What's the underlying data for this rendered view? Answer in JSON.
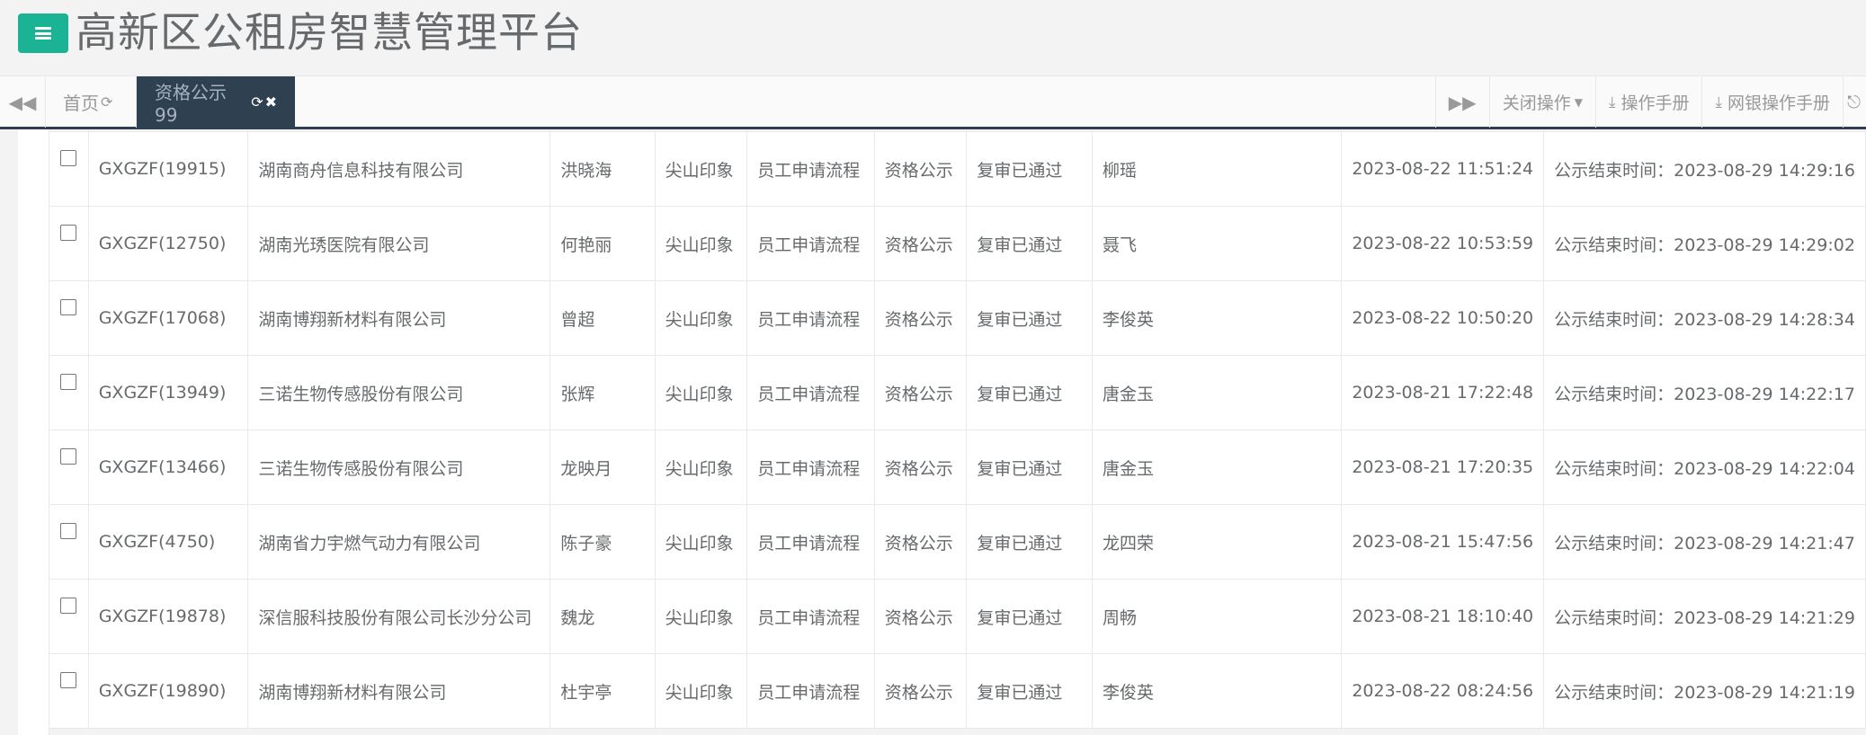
{
  "header": {
    "menu_icon": "hamburger-icon",
    "title": "高新区公租房智慧管理平台"
  },
  "tabbar": {
    "nav_left_icon": "double-chevron-left-icon",
    "tabs": [
      {
        "label": "首页",
        "icon": "refresh-icon"
      },
      {
        "label": "资格公示99",
        "icons": [
          "refresh-icon",
          "close-icon"
        ]
      }
    ],
    "nav_right_icon": "double-chevron-right-icon",
    "close_ops_label": "关闭操作",
    "manual_label": "操作手册",
    "bank_manual_label": "网银操作手册",
    "exit_icon": "exit-icon"
  },
  "table": {
    "rows": [
      {
        "code": "GXGZF(19915)",
        "company": "湖南商舟信息科技有限公司",
        "applicant": "洪晓海",
        "project": "尖山印象",
        "flow": "员工申请流程",
        "stage": "资格公示",
        "status": "复审已通过",
        "reviewer": "柳瑶",
        "time": "2023-08-22 11:51:24",
        "end_time": "公示结束时间：2023-08-29 14:29:16"
      },
      {
        "code": "GXGZF(12750)",
        "company": "湖南光琇医院有限公司",
        "applicant": "何艳丽",
        "project": "尖山印象",
        "flow": "员工申请流程",
        "stage": "资格公示",
        "status": "复审已通过",
        "reviewer": "聂飞",
        "time": "2023-08-22 10:53:59",
        "end_time": "公示结束时间：2023-08-29 14:29:02"
      },
      {
        "code": "GXGZF(17068)",
        "company": "湖南博翔新材料有限公司",
        "applicant": "曾超",
        "project": "尖山印象",
        "flow": "员工申请流程",
        "stage": "资格公示",
        "status": "复审已通过",
        "reviewer": "李俊英",
        "time": "2023-08-22 10:50:20",
        "end_time": "公示结束时间：2023-08-29 14:28:34"
      },
      {
        "code": "GXGZF(13949)",
        "company": "三诺生物传感股份有限公司",
        "applicant": "张辉",
        "project": "尖山印象",
        "flow": "员工申请流程",
        "stage": "资格公示",
        "status": "复审已通过",
        "reviewer": "唐金玉",
        "time": "2023-08-21 17:22:48",
        "end_time": "公示结束时间：2023-08-29 14:22:17"
      },
      {
        "code": "GXGZF(13466)",
        "company": "三诺生物传感股份有限公司",
        "applicant": "龙映月",
        "project": "尖山印象",
        "flow": "员工申请流程",
        "stage": "资格公示",
        "status": "复审已通过",
        "reviewer": "唐金玉",
        "time": "2023-08-21 17:20:35",
        "end_time": "公示结束时间：2023-08-29 14:22:04"
      },
      {
        "code": "GXGZF(4750)",
        "company": "湖南省力宇燃气动力有限公司",
        "applicant": "陈子豪",
        "project": "尖山印象",
        "flow": "员工申请流程",
        "stage": "资格公示",
        "status": "复审已通过",
        "reviewer": "龙四荣",
        "time": "2023-08-21 15:47:56",
        "end_time": "公示结束时间：2023-08-29 14:21:47"
      },
      {
        "code": "GXGZF(19878)",
        "company": "深信服科技股份有限公司长沙分公司",
        "applicant": "魏龙",
        "project": "尖山印象",
        "flow": "员工申请流程",
        "stage": "资格公示",
        "status": "复审已通过",
        "reviewer": "周畅",
        "time": "2023-08-21 18:10:40",
        "end_time": "公示结束时间：2023-08-29 14:21:29"
      },
      {
        "code": "GXGZF(19890)",
        "company": "湖南博翔新材料有限公司",
        "applicant": "杜宇亭",
        "project": "尖山印象",
        "flow": "员工申请流程",
        "stage": "资格公示",
        "status": "复审已通过",
        "reviewer": "李俊英",
        "time": "2023-08-22 08:24:56",
        "end_time": "公示结束时间：2023-08-29 14:21:19"
      }
    ]
  }
}
